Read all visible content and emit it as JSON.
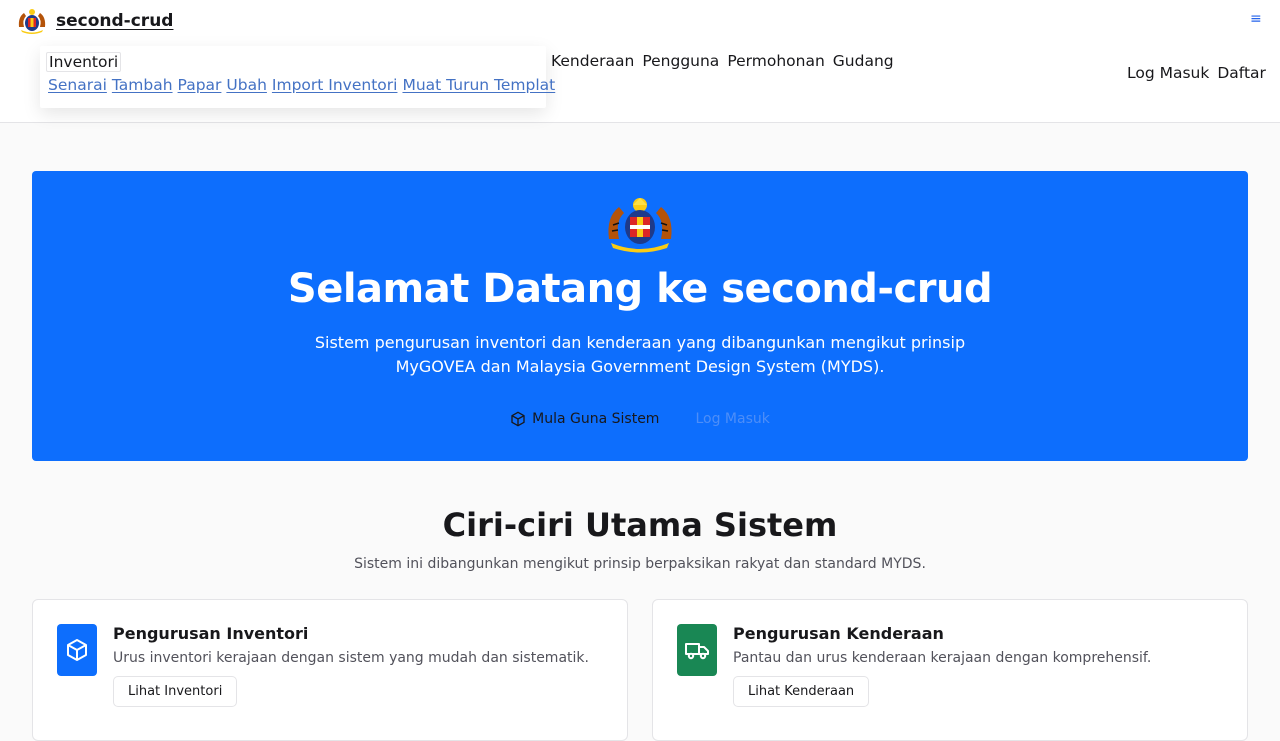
{
  "brand": {
    "name": "second-crud"
  },
  "header": {
    "menu_icon": "hamburger-icon",
    "menu_glyph": "≡",
    "nav": {
      "inventori": "Inventori",
      "inventori_sub": [
        "Senarai",
        "Tambah",
        "Papar",
        "Ubah",
        "Import Inventori",
        "Muat Turun Templat"
      ],
      "center": [
        "Kenderaan",
        "Pengguna",
        "Permohonan",
        "Gudang"
      ],
      "right": [
        "Log Masuk",
        "Daftar"
      ]
    }
  },
  "hero": {
    "title": "Selamat Datang ke second-crud",
    "subtitle": "Sistem pengurusan inventori dan kenderaan yang dibangunkan mengikut prinsip MyGOVEA dan Malaysia Government Design System (MYDS).",
    "start_button": "Mula Guna Sistem",
    "start_icon": "box-icon",
    "login_button": "Log Masuk",
    "colors": {
      "background": "#0d6efd",
      "text": "#ffffff"
    }
  },
  "features": {
    "title": "Ciri-ciri Utama Sistem",
    "subtitle": "Sistem ini dibangunkan mengikut prinsip berpaksikan rakyat dan standard MYDS.",
    "cards": [
      {
        "title": "Pengurusan Inventori",
        "description": "Urus inventori kerajaan dengan sistem yang mudah dan sistematik.",
        "button": "Lihat Inventori",
        "icon": "box-icon",
        "icon_color": "#0d6efd"
      },
      {
        "title": "Pengurusan Kenderaan",
        "description": "Pantau dan urus kenderaan kerajaan dengan komprehensif.",
        "button": "Lihat Kenderaan",
        "icon": "truck-icon",
        "icon_color": "#198754"
      }
    ]
  }
}
